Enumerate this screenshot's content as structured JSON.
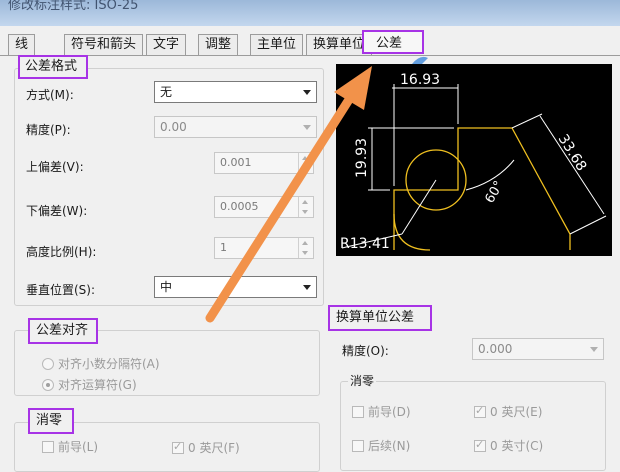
{
  "window": {
    "title": "修改标注样式: ISO-25"
  },
  "tabs": [
    {
      "label": "线"
    },
    {
      "label": "符号和箭头"
    },
    {
      "label": "文字"
    },
    {
      "label": "调整"
    },
    {
      "label": "主单位"
    },
    {
      "label": "换算单位"
    },
    {
      "label": "公差"
    }
  ],
  "tolerance_format": {
    "heading": "公差格式",
    "method_label": "方式(M):",
    "method_value": "无",
    "precision_label": "精度(P):",
    "precision_value": "0.00",
    "upper_label": "上偏差(V):",
    "upper_value": "0.001",
    "lower_label": "下偏差(W):",
    "lower_value": "0.0005",
    "scale_label": "高度比例(H):",
    "scale_value": "1",
    "vpos_label": "垂直位置(S):",
    "vpos_value": "中"
  },
  "tolerance_align": {
    "heading": "公差对齐",
    "opt_decimal": "对齐小数分隔符(A)",
    "opt_operator": "对齐运算符(G)"
  },
  "zero_suppress": {
    "heading": "消零",
    "leading": "前导(L)",
    "feet": "0 英尺(F)"
  },
  "alt_units": {
    "heading": "换算单位公差",
    "precision_label": "精度(O):",
    "precision_value": "0.000",
    "zero_heading": "消零",
    "leading": "前导(D)",
    "trailing": "后续(N)",
    "feet": "0 英尺(E)",
    "inches": "0 英寸(C)"
  },
  "preview": {
    "dim_top": "16.93",
    "dim_left": "19.93",
    "dim_right": "33.68",
    "dim_angle": "60°",
    "dim_radius": "R13.41"
  },
  "colors": {
    "highlight": "#a733e6",
    "arrow": "#f2924a",
    "drawing": "#f0c020"
  }
}
